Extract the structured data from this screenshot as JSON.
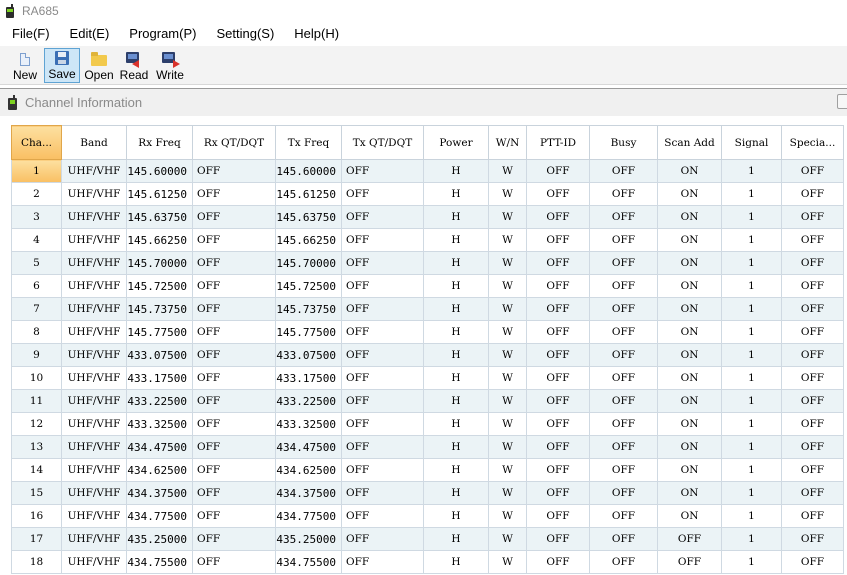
{
  "app": {
    "title": "RA685"
  },
  "menu": [
    "File(F)",
    "Edit(E)",
    "Program(P)",
    "Setting(S)",
    "Help(H)"
  ],
  "toolbar": {
    "new": "New",
    "save": "Save",
    "open": "Open",
    "read": "Read",
    "write": "Write"
  },
  "child_window": {
    "title": "Channel Information"
  },
  "grid": {
    "columns": [
      "Cha...",
      "Band",
      "Rx Freq",
      "Rx QT/DQT",
      "Tx Freq",
      "Tx QT/DQT",
      "Power",
      "W/N",
      "PTT-ID",
      "Busy",
      "Scan Add",
      "Signal",
      "Specia..."
    ],
    "rows": [
      [
        "1",
        "UHF/VHF",
        "145.60000",
        "OFF",
        "145.60000",
        "OFF",
        "H",
        "W",
        "OFF",
        "OFF",
        "ON",
        "1",
        "OFF"
      ],
      [
        "2",
        "UHF/VHF",
        "145.61250",
        "OFF",
        "145.61250",
        "OFF",
        "H",
        "W",
        "OFF",
        "OFF",
        "ON",
        "1",
        "OFF"
      ],
      [
        "3",
        "UHF/VHF",
        "145.63750",
        "OFF",
        "145.63750",
        "OFF",
        "H",
        "W",
        "OFF",
        "OFF",
        "ON",
        "1",
        "OFF"
      ],
      [
        "4",
        "UHF/VHF",
        "145.66250",
        "OFF",
        "145.66250",
        "OFF",
        "H",
        "W",
        "OFF",
        "OFF",
        "ON",
        "1",
        "OFF"
      ],
      [
        "5",
        "UHF/VHF",
        "145.70000",
        "OFF",
        "145.70000",
        "OFF",
        "H",
        "W",
        "OFF",
        "OFF",
        "ON",
        "1",
        "OFF"
      ],
      [
        "6",
        "UHF/VHF",
        "145.72500",
        "OFF",
        "145.72500",
        "OFF",
        "H",
        "W",
        "OFF",
        "OFF",
        "ON",
        "1",
        "OFF"
      ],
      [
        "7",
        "UHF/VHF",
        "145.73750",
        "OFF",
        "145.73750",
        "OFF",
        "H",
        "W",
        "OFF",
        "OFF",
        "ON",
        "1",
        "OFF"
      ],
      [
        "8",
        "UHF/VHF",
        "145.77500",
        "OFF",
        "145.77500",
        "OFF",
        "H",
        "W",
        "OFF",
        "OFF",
        "ON",
        "1",
        "OFF"
      ],
      [
        "9",
        "UHF/VHF",
        "433.07500",
        "OFF",
        "433.07500",
        "OFF",
        "H",
        "W",
        "OFF",
        "OFF",
        "ON",
        "1",
        "OFF"
      ],
      [
        "10",
        "UHF/VHF",
        "433.17500",
        "OFF",
        "433.17500",
        "OFF",
        "H",
        "W",
        "OFF",
        "OFF",
        "ON",
        "1",
        "OFF"
      ],
      [
        "11",
        "UHF/VHF",
        "433.22500",
        "OFF",
        "433.22500",
        "OFF",
        "H",
        "W",
        "OFF",
        "OFF",
        "ON",
        "1",
        "OFF"
      ],
      [
        "12",
        "UHF/VHF",
        "433.32500",
        "OFF",
        "433.32500",
        "OFF",
        "H",
        "W",
        "OFF",
        "OFF",
        "ON",
        "1",
        "OFF"
      ],
      [
        "13",
        "UHF/VHF",
        "434.47500",
        "OFF",
        "434.47500",
        "OFF",
        "H",
        "W",
        "OFF",
        "OFF",
        "ON",
        "1",
        "OFF"
      ],
      [
        "14",
        "UHF/VHF",
        "434.62500",
        "OFF",
        "434.62500",
        "OFF",
        "H",
        "W",
        "OFF",
        "OFF",
        "ON",
        "1",
        "OFF"
      ],
      [
        "15",
        "UHF/VHF",
        "434.37500",
        "OFF",
        "434.37500",
        "OFF",
        "H",
        "W",
        "OFF",
        "OFF",
        "ON",
        "1",
        "OFF"
      ],
      [
        "16",
        "UHF/VHF",
        "434.77500",
        "OFF",
        "434.77500",
        "OFF",
        "H",
        "W",
        "OFF",
        "OFF",
        "ON",
        "1",
        "OFF"
      ],
      [
        "17",
        "UHF/VHF",
        "435.25000",
        "OFF",
        "435.25000",
        "OFF",
        "H",
        "W",
        "OFF",
        "OFF",
        "OFF",
        "1",
        "OFF"
      ],
      [
        "18",
        "UHF/VHF",
        "434.75500",
        "OFF",
        "434.75500",
        "OFF",
        "H",
        "W",
        "OFF",
        "OFF",
        "OFF",
        "1",
        "OFF"
      ]
    ]
  }
}
